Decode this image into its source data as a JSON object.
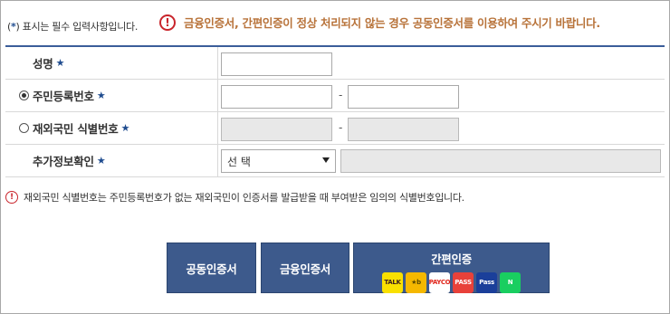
{
  "top_note": {
    "prefix": "(",
    "star": "*",
    "suffix": ") 표시는 필수 입력사항입니다."
  },
  "top_warning": {
    "icon": "!",
    "text": "금융인증서, 간편인증이 정상 처리되지 않는 경우 공동인증서를 이용하여 주시기 바랍니다."
  },
  "form": {
    "name": {
      "label": "성명",
      "star": "★",
      "value": ""
    },
    "rrn": {
      "label": "주민등록번호",
      "star": "★",
      "selected": true,
      "front": "",
      "back": "",
      "dash": "-"
    },
    "foreign": {
      "label": "재외국민 식별번호",
      "star": "★",
      "selected": false,
      "front": "",
      "back": "",
      "dash": "-"
    },
    "extra": {
      "label": "추가정보확인",
      "star": "★",
      "select_value": "선 택",
      "extra_value": ""
    }
  },
  "info_note": {
    "icon": "!",
    "text": "재외국민 식별번호는 주민등록번호가 없는 재외국민이 인증서를 발급받을 때 부여받은 임의의 식별번호입니다."
  },
  "buttons": {
    "joint_cert": "공동인증서",
    "finance_cert": "금융인증서",
    "simple_auth": "간편인증",
    "simple_icons": [
      {
        "name": "kakao-talk-icon",
        "label": "TALK",
        "bg": "#f9e000",
        "fg": "#3c1e1e"
      },
      {
        "name": "kb-icon",
        "label": "★b",
        "bg": "#f5b800",
        "fg": "#5a4a00"
      },
      {
        "name": "payco-icon",
        "label": "PAYCO",
        "bg": "#ffffff",
        "fg": "#e1251b"
      },
      {
        "name": "pass-icon",
        "label": "PASS",
        "bg": "#e8413a",
        "fg": "#ffffff"
      },
      {
        "name": "samsung-pass-icon",
        "label": "Pass",
        "bg": "#1b3f9a",
        "fg": "#ffffff"
      },
      {
        "name": "naver-icon",
        "label": "N",
        "bg": "#19ce60",
        "fg": "#ffffff"
      }
    ]
  },
  "colors": {
    "primary_button": "#3d5a8c",
    "warning_red": "#c9252c",
    "warning_text": "#b8733a",
    "table_top_border": "#3b5d99"
  }
}
